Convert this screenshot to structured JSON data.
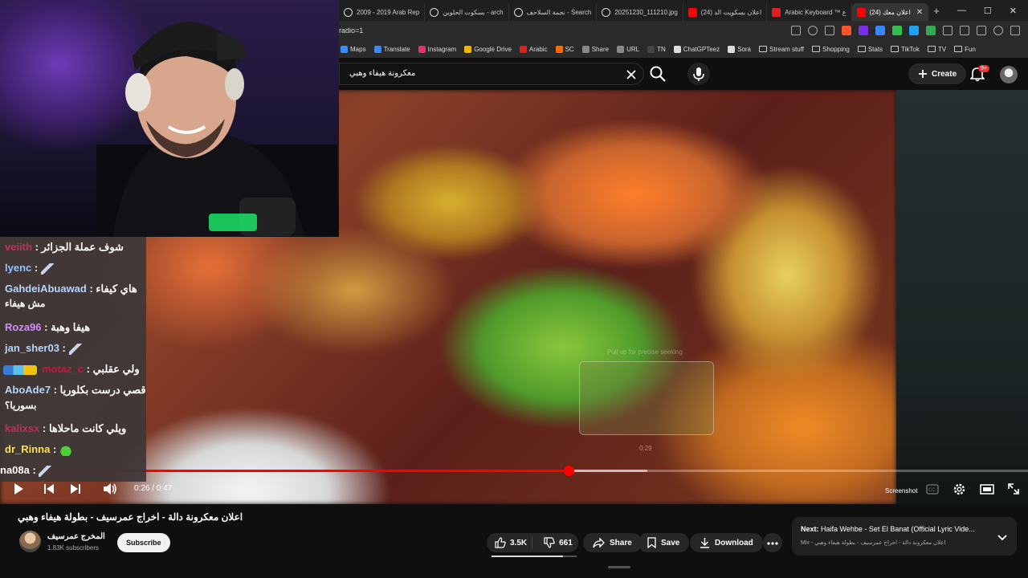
{
  "browser": {
    "tabs": [
      {
        "label": "2009 - 2019 Arab Rep",
        "icon_color": "#ffffff"
      },
      {
        "label": "بسكوت الحلوين - arch",
        "icon_color": "#ffffff"
      },
      {
        "label": "نجمة السلاحف - Search",
        "icon_color": "#ffffff"
      },
      {
        "label": "20251230_111210.jpg",
        "icon_color": "#ffffff"
      },
      {
        "label": "(24) اعلان بسكويت الد",
        "icon_color": "#ff0000"
      },
      {
        "label": "Arabic Keyboard ™ ع",
        "icon_color": "#e02020"
      },
      {
        "label": "(24) اعلان معك",
        "icon_color": "#ff0000",
        "active": true
      }
    ],
    "new_tab_label": "+",
    "url_fragment": "radio=1",
    "bookmarks": [
      {
        "label": "Maps",
        "color": "#3a8bff"
      },
      {
        "label": "Translate",
        "color": "#4285f4"
      },
      {
        "label": "Instagram",
        "color": "#e1306c"
      },
      {
        "label": "Google Drive",
        "color": "#f4b400"
      },
      {
        "label": "Arabic",
        "color": "#e02020"
      },
      {
        "label": "SC",
        "color": "#ff6b00"
      },
      {
        "label": "Share",
        "color": "#888888"
      },
      {
        "label": "URL",
        "color": "#888888"
      },
      {
        "label": "TN",
        "color": "#444444"
      },
      {
        "label": "ChatGPTeez",
        "color": "#dddddd"
      },
      {
        "label": "Sora",
        "color": "#dddddd"
      },
      {
        "label": "Stream stuff",
        "folder": true
      },
      {
        "label": "Shopping",
        "folder": true
      },
      {
        "label": "Stats",
        "folder": true
      },
      {
        "label": "TikTok",
        "folder": true
      },
      {
        "label": "TV",
        "folder": true
      },
      {
        "label": "Fun",
        "folder": true
      }
    ]
  },
  "youtube": {
    "search_query": "معكرونة هيفاء وهبي",
    "create_label": "Create",
    "notification_badge": "9+",
    "player": {
      "current_time": "0:26",
      "duration": "0:47",
      "time_display": "0:26 / 0:47",
      "progress_fraction": 0.553,
      "hover_fraction": 0.63,
      "seek_preview_time": "0:29",
      "pull_up_hint": "Pull up for precise seeking",
      "screenshot_label": "Screenshot"
    },
    "video_title": "اعلان معكرونة دالة - اخراج عمرسيف - بطولة هيفاء وهبي",
    "channel": {
      "name": "المخرج عمرسيف",
      "subscribers": "1.83K subscribers",
      "subscribe_label": "Subscribe"
    },
    "actions": {
      "likes": "3.5K",
      "dislikes": "661",
      "like_ratio": 0.84,
      "share_label": "Share",
      "save_label": "Save",
      "download_label": "Download"
    },
    "next_up": {
      "prefix": "Next:",
      "title": "Haifa Wehbe - Set El Banat (Official Lyric Vide...",
      "subtitle": "Mix - اعلان معكرونة دالة - اخراج عمرسيف - بطولة هيفاء وهبي"
    }
  },
  "chat": {
    "messages": [
      {
        "user": "veiith",
        "color": "#c0305a",
        "text": "شوف عملة الجزائر"
      },
      {
        "user": "lyenc",
        "color": "#8fc2ff",
        "text": "",
        "emote": "feather"
      },
      {
        "user": "GahdeiAbuawad",
        "color": "#b3d6ff",
        "text": "هاي كيفاء",
        "text2": "مش هيفاء"
      },
      {
        "user": "Roza96",
        "color": "#d68aff",
        "text": "هيفا وهبة"
      },
      {
        "user": "jan_sher03",
        "color": "#b3d6ff",
        "text": "",
        "emote": "feather"
      },
      {
        "user": "motaz_c",
        "color": "#d01040",
        "text": "ولي عقلبي",
        "badges": true
      },
      {
        "user": "AboAde7",
        "color": "#b3d6ff",
        "text": "قصي درست بكلوريا",
        "text2": "بسوريا؟"
      },
      {
        "user": "kalixsx",
        "color": "#c0305a",
        "text": "ويلي كانت ماحلاها"
      },
      {
        "user": "dr_Rinna",
        "color": "#ffe34a",
        "text": "",
        "emote": "frog"
      },
      {
        "user": "na08a",
        "color": "#ffffff",
        "text": "",
        "emote": "feather"
      }
    ]
  }
}
